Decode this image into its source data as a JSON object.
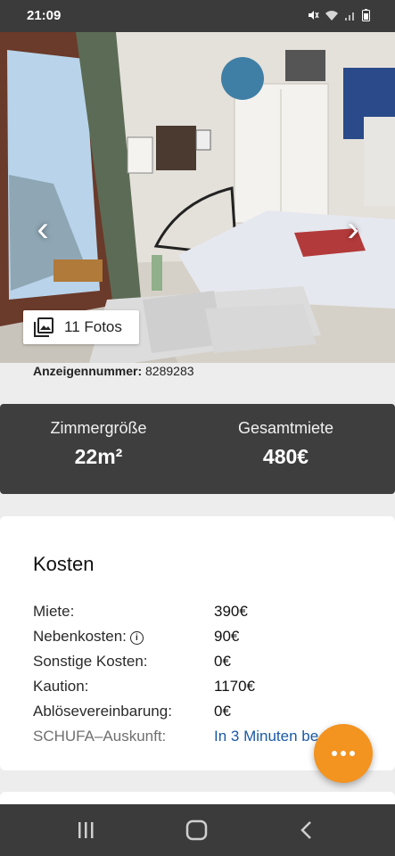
{
  "status_bar": {
    "time": "21:09",
    "icons": [
      "mute-icon",
      "wifi-icon",
      "signal-icon",
      "battery-icon"
    ]
  },
  "gallery": {
    "prev_icon": "‹",
    "next_icon": "›",
    "photo_count_label": "11 Fotos"
  },
  "listing": {
    "ad_number_label": "Anzeigennummer:",
    "ad_number_value": "8289283"
  },
  "stats": {
    "room_size_label": "Zimmergröße",
    "room_size_value": "22m²",
    "total_rent_label": "Gesamtmiete",
    "total_rent_value": "480€"
  },
  "costs": {
    "title": "Kosten",
    "rows": [
      {
        "label": "Miete:",
        "value": "390€"
      },
      {
        "label": "Nebenkosten:",
        "value": "90€"
      },
      {
        "label": "Sonstige Kosten:",
        "value": "0€"
      },
      {
        "label": "Kaution:",
        "value": "1170€"
      },
      {
        "label": "Ablösevereinbarung:",
        "value": "0€"
      },
      {
        "label": "SCHUFA–Auskunft:",
        "value": "In 3 Minuten be"
      }
    ]
  },
  "colors": {
    "accent": "#f39320",
    "dark_panel": "#3e3e3e",
    "link": "#1a5aa6"
  }
}
